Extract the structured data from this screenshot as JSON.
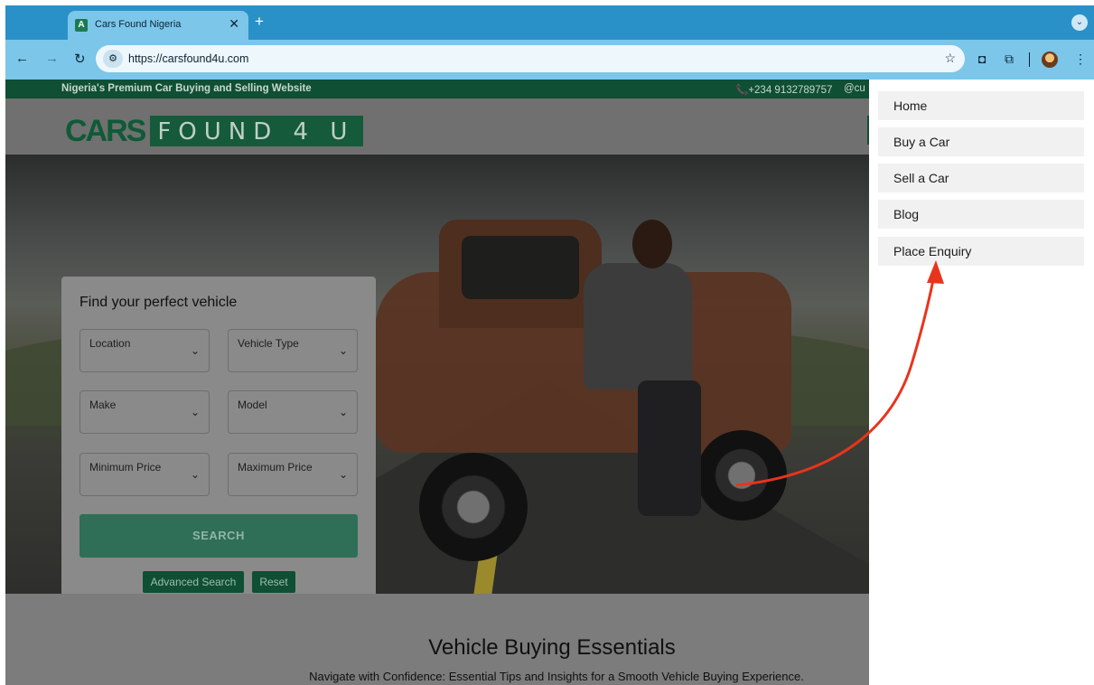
{
  "browser": {
    "tab_title": "Cars Found Nigeria",
    "tab_favicon": "A",
    "url": "https://carsfound4u.com",
    "icons": [
      "back-icon",
      "forward-icon",
      "reload-icon",
      "site-info-icon",
      "bookmark-star-icon",
      "camera-icon",
      "extensions-icon",
      "profile-avatar",
      "more-menu-icon"
    ]
  },
  "topbar": {
    "tagline": "Nigeria's Premium Car Buying and Selling Website",
    "phone": "📞+234 9132789757",
    "email": "@cu"
  },
  "logo": {
    "left": "CARS",
    "right": "FOUND 4 U"
  },
  "search": {
    "title": "Find your perfect vehicle",
    "location": "Location",
    "vehicle_type": "Vehicle Type",
    "make": "Make",
    "model": "Model",
    "min_price": "Minimum Price",
    "max_price": "Maximum Price",
    "search_button": "SEARCH",
    "advanced_button": "Advanced Search",
    "reset_button": "Reset"
  },
  "section": {
    "title": "Vehicle Buying Essentials",
    "subtitle": "Navigate with Confidence: Essential Tips and Insights for a Smooth Vehicle Buying Experience."
  },
  "menu": {
    "items": [
      "Home",
      "Buy a Car",
      "Sell a Car",
      "Blog",
      "Place Enquiry"
    ]
  },
  "colors": {
    "brand_green": "#0f4f33",
    "annotation_arrow": "#e8341c"
  }
}
